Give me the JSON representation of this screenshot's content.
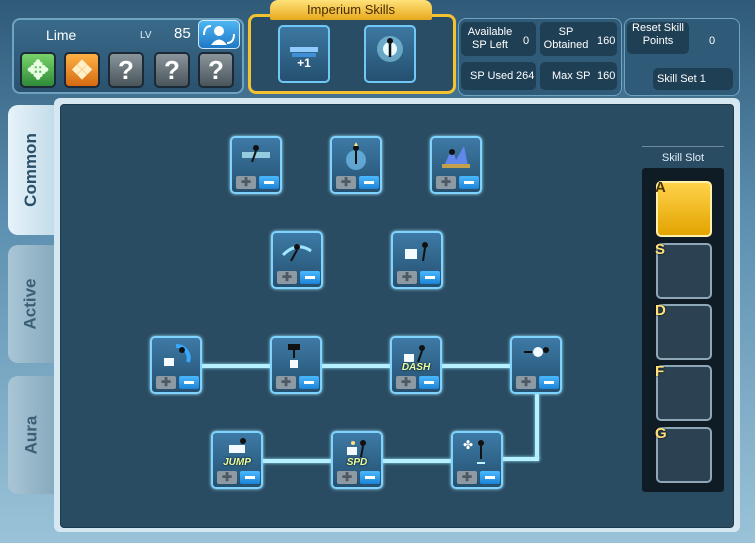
{
  "character": {
    "name": "Lime",
    "level_label": "LV",
    "level": "85"
  },
  "job_icons": [
    {
      "name": "job-green-emblem-icon",
      "glyph": "✥",
      "style": "g"
    },
    {
      "name": "job-orange-emblem-icon",
      "glyph": "❖",
      "style": "o"
    },
    {
      "name": "job-locked-icon",
      "glyph": "?",
      "style": "q"
    },
    {
      "name": "job-locked-icon",
      "glyph": "?",
      "style": "q"
    },
    {
      "name": "job-locked-icon",
      "glyph": "?",
      "style": "q"
    }
  ],
  "imperium": {
    "title": "Imperium Skills",
    "slot1_label": "+1"
  },
  "sp": {
    "available_label": "Available SP Left",
    "available": "0",
    "obtained_label": "SP Obtained",
    "obtained": "160",
    "used_label": "SP Used",
    "used": "264",
    "max_label": "Max SP",
    "max": "160"
  },
  "reset": {
    "label": "Reset Skill Points",
    "value": "0",
    "skill_set": "Skill Set 1"
  },
  "tabs": [
    {
      "label": "Common",
      "active": true
    },
    {
      "label": "Active",
      "active": false
    },
    {
      "label": "Aura",
      "active": false
    }
  ],
  "skills": [
    {
      "name": "skill-dash-strike",
      "label": ""
    },
    {
      "name": "skill-power-up",
      "label": ""
    },
    {
      "name": "skill-ground-burst",
      "label": ""
    },
    {
      "name": "skill-spin-slash",
      "label": ""
    },
    {
      "name": "skill-block",
      "label": ""
    },
    {
      "name": "skill-shield-guard",
      "label": ""
    },
    {
      "name": "skill-hammer-smash",
      "label": ""
    },
    {
      "name": "skill-dash",
      "label": "DASH"
    },
    {
      "name": "skill-throw",
      "label": ""
    },
    {
      "name": "skill-jump",
      "label": "JUMP"
    },
    {
      "name": "skill-speed",
      "label": "SPD"
    },
    {
      "name": "skill-evade",
      "label": ""
    }
  ],
  "slots": {
    "title": "Skill Slot",
    "keys": [
      "A",
      "S",
      "D",
      "F",
      "G"
    ],
    "selected": "A"
  },
  "colors": {
    "accent_gold": "#f2c231",
    "node_border": "#7fd4ff",
    "board": "#2a4c63"
  }
}
